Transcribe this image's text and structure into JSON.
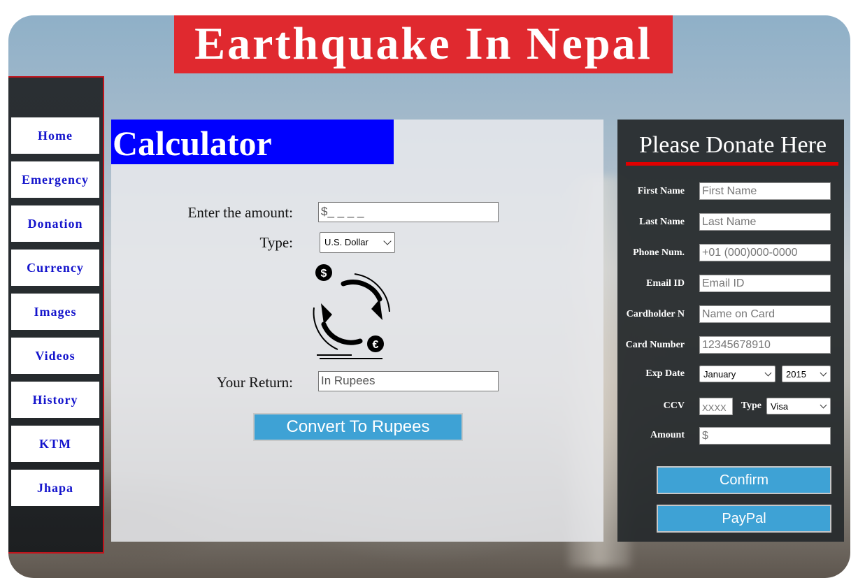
{
  "header": {
    "title": "Earthquake In Nepal"
  },
  "sidebar": {
    "items": [
      {
        "label": "Home"
      },
      {
        "label": "Emergency"
      },
      {
        "label": "Donation"
      },
      {
        "label": "Currency"
      },
      {
        "label": "Images"
      },
      {
        "label": "Videos"
      },
      {
        "label": "History"
      },
      {
        "label": "KTM"
      },
      {
        "label": "Jhapa"
      }
    ]
  },
  "calculator": {
    "title": "Calculator",
    "amount_label": "Enter the amount:",
    "amount_value": "$_ _ _ _",
    "type_label": "Type:",
    "type_selected": "U.S. Dollar",
    "return_label": "Your Return:",
    "return_placeholder": "In Rupees",
    "convert_label": "Convert To Rupees",
    "icon": "currency-exchange-icon",
    "exchange_symbols": [
      "$",
      "€"
    ]
  },
  "donate": {
    "title": "Please Donate Here",
    "fields": {
      "first_name": {
        "label": "First Name",
        "placeholder": "First Name"
      },
      "last_name": {
        "label": "Last Name",
        "placeholder": "Last Name"
      },
      "phone": {
        "label": "Phone Num.",
        "placeholder": "+01 (000)000-0000"
      },
      "email": {
        "label": "Email ID",
        "placeholder": "Email ID"
      },
      "cardholder": {
        "label": "Cardholder N",
        "placeholder": "Name on Card"
      },
      "card_number": {
        "label": "Card Number",
        "placeholder": "12345678910"
      },
      "exp_date": {
        "label": "Exp Date",
        "month": "January",
        "year": "2015"
      },
      "ccv": {
        "label": "CCV",
        "placeholder": "XXXX"
      },
      "type": {
        "label": "Type",
        "selected": "Visa"
      },
      "amount": {
        "label": "Amount",
        "placeholder": "$"
      }
    },
    "confirm_label": "Confirm",
    "paypal_label": "PayPal"
  },
  "colors": {
    "title_bg": "#e0292f",
    "calc_title_bg": "#0000ff",
    "nav_text": "#1414cc",
    "button_bg": "#3ea2d5",
    "panel_dark": "#262a2d",
    "sidebar_border": "#c0141c"
  }
}
